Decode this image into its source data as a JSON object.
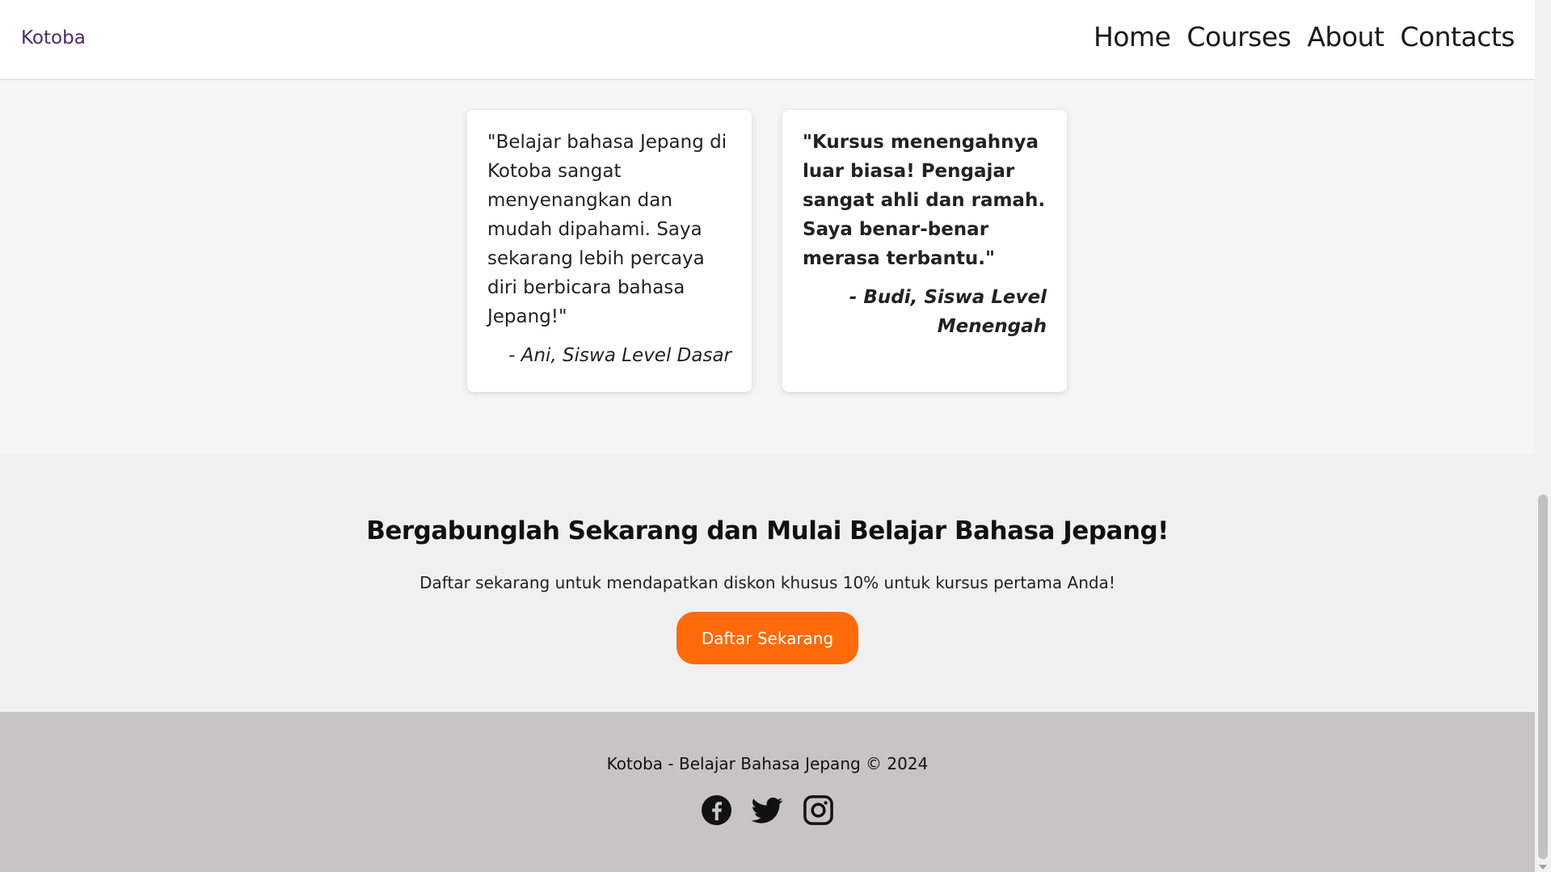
{
  "nav": {
    "logo": "Kotoba",
    "links": [
      "Home",
      "Courses",
      "About",
      "Contacts"
    ]
  },
  "testimonials": [
    {
      "quote": "\"Belajar bahasa Jepang di Kotoba sangat menyenangkan dan mudah dipahami. Saya sekarang lebih percaya diri berbicara bahasa Jepang!\"",
      "author": "- Ani, Siswa Level Dasar"
    },
    {
      "quote": "\"Kursus menengahnya luar biasa! Pengajar sangat ahli dan ramah. Saya benar-benar merasa terbantu.\"",
      "author": "- Budi, Siswa Level Menengah"
    }
  ],
  "cta": {
    "title": "Bergabunglah Sekarang dan Mulai Belajar Bahasa Jepang!",
    "text": "Daftar sekarang untuk mendapatkan diskon khusus 10% untuk kursus pertama Anda!",
    "button": "Daftar Sekarang"
  },
  "footer": {
    "text": "Kotoba - Belajar Bahasa Jepang © 2024",
    "socials": [
      "facebook-icon",
      "twitter-icon",
      "instagram-icon"
    ]
  },
  "colors": {
    "accent": "#ff6a0a",
    "logo": "#4b2a6b",
    "footer_bg": "#c9c4c4"
  }
}
